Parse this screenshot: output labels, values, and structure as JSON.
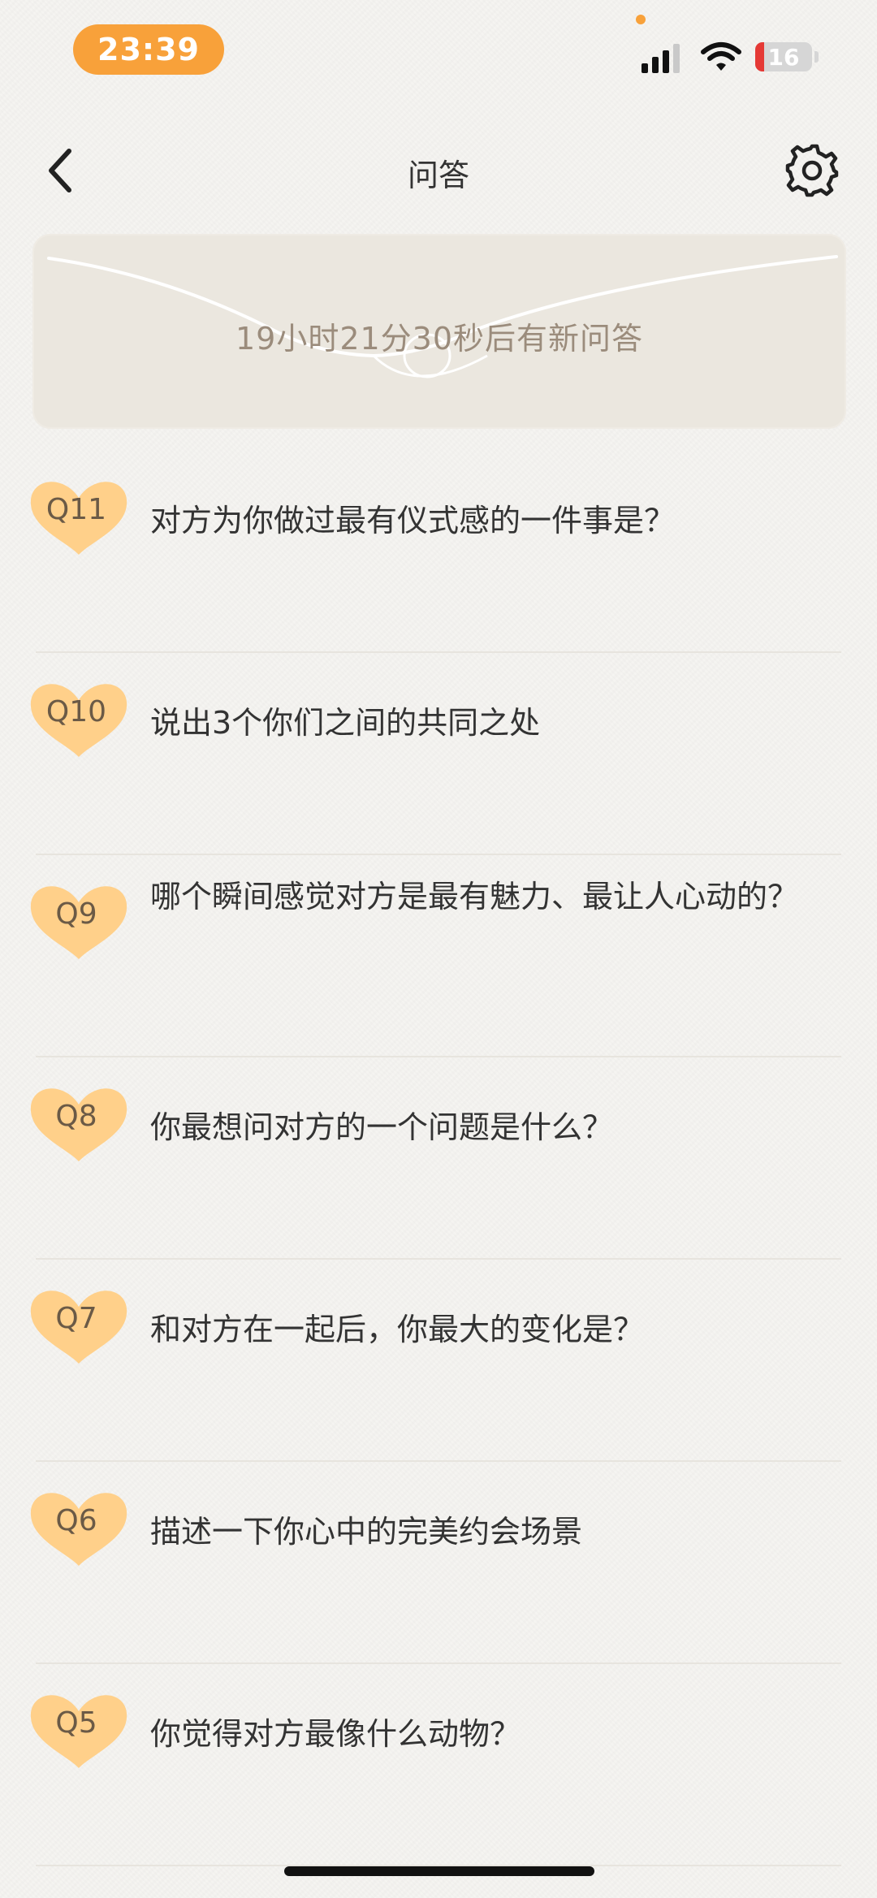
{
  "status_bar": {
    "time": "23:39",
    "battery": "16",
    "battery_percent": 16,
    "accent": "#f8a13a"
  },
  "nav": {
    "title": "问答",
    "back_icon": "chevron-left-icon",
    "settings_icon": "gear-icon"
  },
  "banner": {
    "countdown": "19小时21分30秒后有新问答"
  },
  "questions": [
    {
      "label": "Q11",
      "text": "对方为你做过最有仪式感的一件事是？"
    },
    {
      "label": "Q10",
      "text": "说出3个你们之间的共同之处"
    },
    {
      "label": "Q9",
      "text": "哪个瞬间感觉对方是最有魅力、最让人心动的？"
    },
    {
      "label": "Q8",
      "text": "你最想问对方的一个问题是什么？"
    },
    {
      "label": "Q7",
      "text": "和对方在一起后，你最大的变化是？"
    },
    {
      "label": "Q6",
      "text": "描述一下你心中的完美约会场景"
    },
    {
      "label": "Q5",
      "text": "你觉得对方最像什么动物？"
    }
  ],
  "colors": {
    "badge": "#ffd08a",
    "badge_text": "#6b5a46",
    "banner_text": "#9b8c7c"
  }
}
